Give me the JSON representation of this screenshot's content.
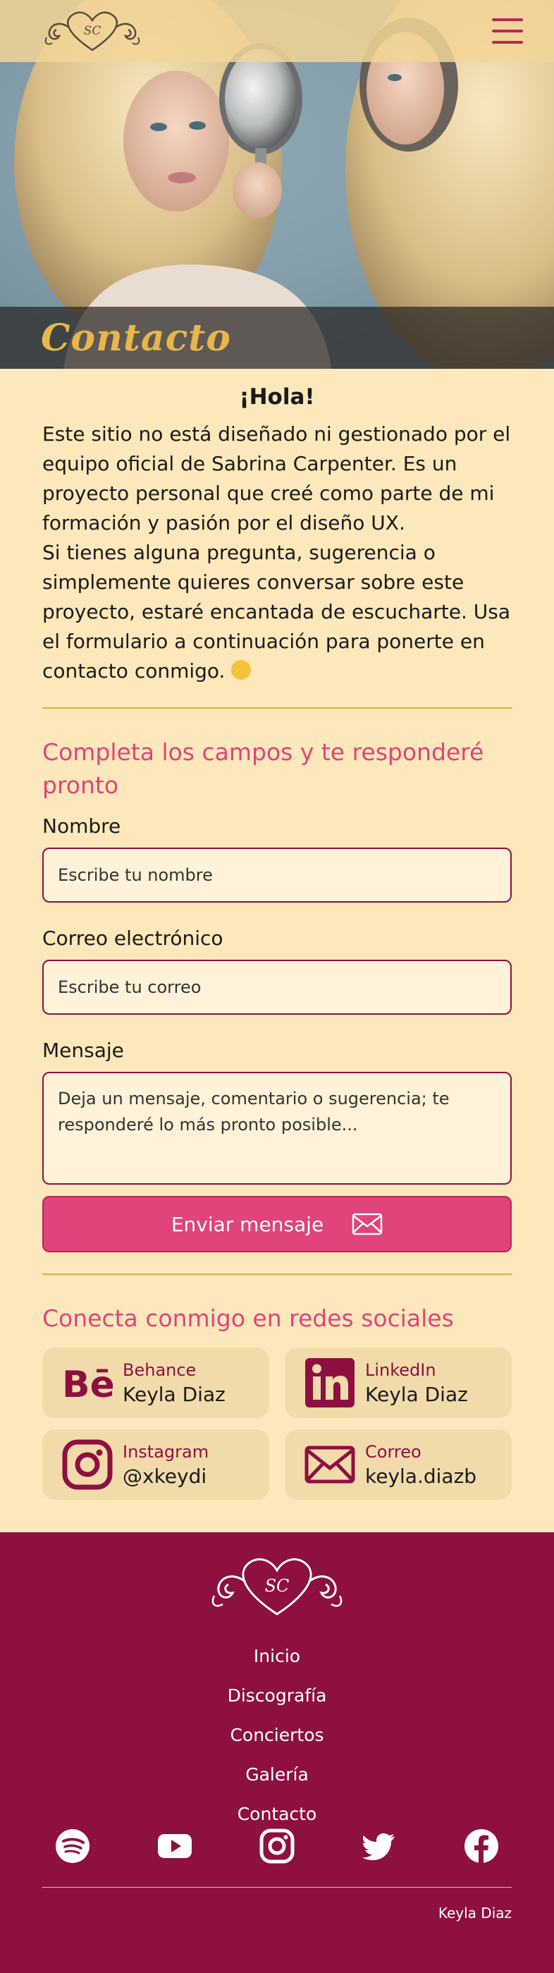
{
  "header": {
    "logo_text": "SC",
    "menu_icon": "hamburger-icon"
  },
  "hero": {
    "title": "Contacto"
  },
  "intro": {
    "heading": "¡Hola!",
    "paragraph_1": "Este sitio no está diseñado ni gestionado por el equipo oficial de Sabrina Carpenter. Es un proyecto personal que creé como parte de mi formación y pasión por el diseño UX.",
    "paragraph_2": "Si tienes alguna pregunta, sugerencia o simplemente quieres conversar sobre este proyecto, estaré encantada de escucharte. Usa el formulario a continuación para ponerte en contacto conmigo."
  },
  "form": {
    "title": "Completa los campos y te responderé pronto",
    "name_label": "Nombre",
    "name_placeholder": "Escribe tu nombre",
    "email_label": "Correo electrónico",
    "email_placeholder": "Escribe tu correo",
    "message_label": "Mensaje",
    "message_placeholder": "Deja un mensaje, comentario o sugerencia; te responderé lo más pronto posible...",
    "submit_label": "Enviar mensaje"
  },
  "social": {
    "title": "Conecta conmigo en redes sociales",
    "cards": [
      {
        "network": "Behance",
        "value": "Keyla Diaz",
        "icon": "behance-icon"
      },
      {
        "network": "LinkedIn",
        "value": "Keyla Diaz",
        "icon": "linkedin-icon"
      },
      {
        "network": "Instagram",
        "value": "@xkeydi",
        "icon": "instagram-icon"
      },
      {
        "network": "Correo",
        "value": "keyla.diazb",
        "icon": "mail-icon"
      }
    ]
  },
  "footer": {
    "nav": [
      "Inicio",
      "Discografía",
      "Conciertos",
      "Galería",
      "Contacto"
    ],
    "icons": [
      "spotify-icon",
      "youtube-icon",
      "instagram-icon",
      "twitter-icon",
      "facebook-icon"
    ],
    "credit": "Keyla Diaz"
  },
  "colors": {
    "background": "#fce8bb",
    "accent": "#e0447a",
    "brand_dark": "#8d1040",
    "hero_title": "#e8b64a",
    "divider": "#e9a93b"
  }
}
